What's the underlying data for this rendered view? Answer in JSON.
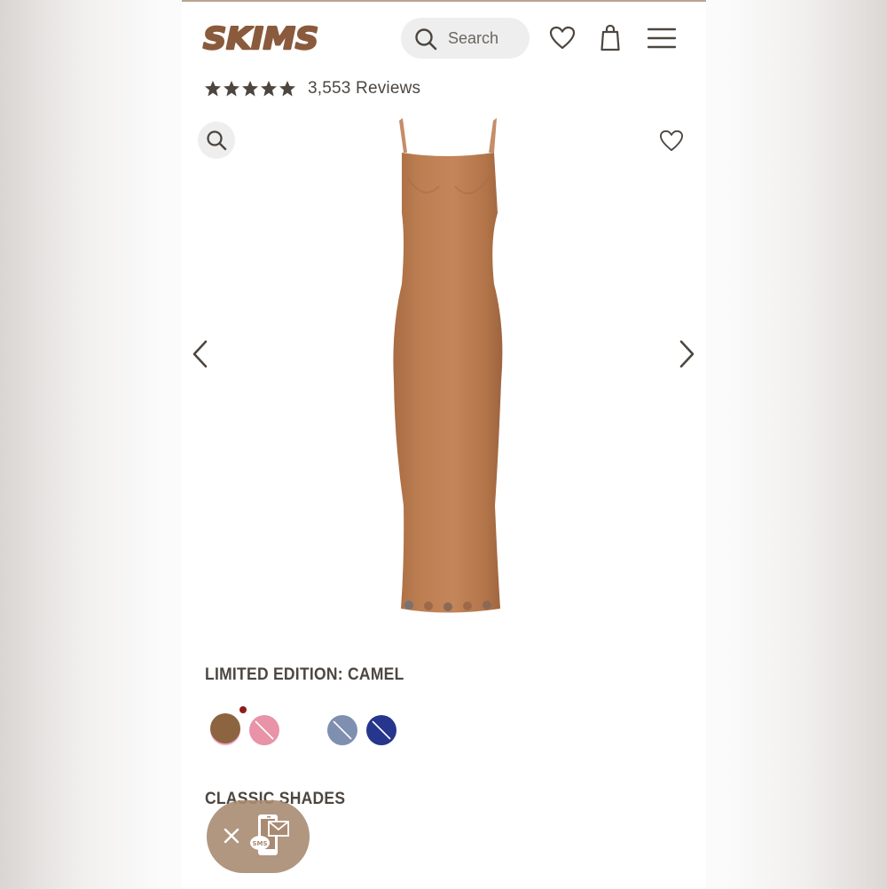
{
  "brand": {
    "logo_text": "SKIMS",
    "logo_icon": "skims-wordmark-logo",
    "color": "#8a5a3c"
  },
  "header": {
    "search_placeholder": "Search",
    "icons": [
      "search-icon",
      "heart-icon",
      "shopping-bag-icon",
      "hamburger-menu-icon"
    ]
  },
  "rating": {
    "stars": 5,
    "reviews_label": "3,553 Reviews"
  },
  "gallery": {
    "product": "camel slip maxi dress",
    "product_color": "#b87a4e",
    "icons": [
      "zoom-icon",
      "heart-icon",
      "chevron-left-icon",
      "chevron-right-icon"
    ]
  },
  "colors": {
    "section_title": "LIMITED EDITION: CAMEL",
    "swatches": [
      {
        "color": "#f2a7cc",
        "sold_out": false,
        "new": true,
        "selected": false
      },
      {
        "color": "#e893a8",
        "sold_out": true,
        "new": false,
        "selected": false
      },
      {
        "color": "#8c6440",
        "sold_out": false,
        "new": false,
        "selected": true
      },
      {
        "color": "#7f8fb0",
        "sold_out": true,
        "new": false,
        "selected": false
      },
      {
        "color": "#25368c",
        "sold_out": true,
        "new": false,
        "selected": false
      }
    ]
  },
  "classic": {
    "section_title": "CLASSIC SHADES"
  },
  "sms_widget": {
    "badge_text": "SMS",
    "icons": [
      "close-icon",
      "sms-phone-icon"
    ],
    "color": "#a88b72"
  }
}
